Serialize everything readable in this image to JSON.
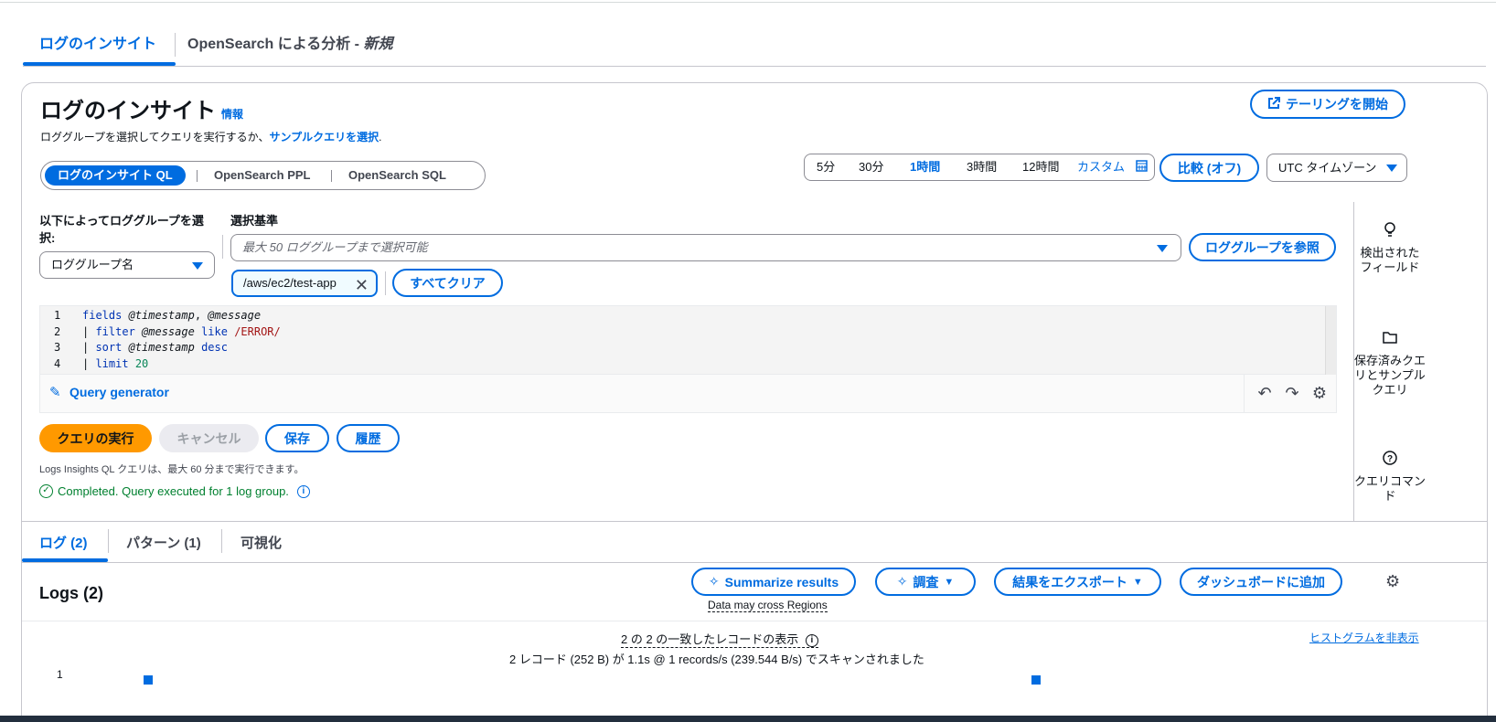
{
  "top_tabs": [
    {
      "label": "ログのインサイト"
    },
    {
      "label_prefix": "OpenSearch による分析 - ",
      "label_suffix": "新規"
    }
  ],
  "header": {
    "title": "ログのインサイト",
    "info": "情報",
    "subtitle": "ロググループを選択してクエリを実行するか、",
    "subtitle_link": "サンプルクエリを選択",
    "subtitle_end": ".",
    "tail_button": "テーリングを開始"
  },
  "query_languages": [
    "ログのインサイト QL",
    "OpenSearch PPL",
    "OpenSearch SQL"
  ],
  "time_range": {
    "options": [
      "5分",
      "30分",
      "1時間",
      "3時間",
      "12時間"
    ],
    "selected": "1時間",
    "custom": "カスタム",
    "compare_button": "比較 (オフ)",
    "timezone": "UTC タイムゾーン"
  },
  "log_group_selection": {
    "select_by_label": "以下によってロググループを選択:",
    "select_by_value": "ロググループ名",
    "criteria_label": "選択基準",
    "criteria_placeholder": "最大 50 ロググループまで選択可能",
    "browse_button": "ロググループを参照",
    "selected_token": "/aws/ec2/test-app",
    "clear_all_button": "すべてクリア"
  },
  "editor": {
    "lines": [
      {
        "n": "1",
        "parts": [
          [
            "kw",
            "fields "
          ],
          [
            "at",
            "@timestamp"
          ],
          [
            "t",
            ", "
          ],
          [
            "at",
            "@message"
          ]
        ]
      },
      {
        "n": "2",
        "parts": [
          [
            "t",
            "| "
          ],
          [
            "kw",
            "filter "
          ],
          [
            "at",
            "@message "
          ],
          [
            "kw",
            "like "
          ],
          [
            "re",
            "/ERROR/"
          ]
        ]
      },
      {
        "n": "3",
        "parts": [
          [
            "t",
            "| "
          ],
          [
            "kw",
            "sort "
          ],
          [
            "at",
            "@timestamp "
          ],
          [
            "kw",
            "desc"
          ]
        ]
      },
      {
        "n": "4",
        "parts": [
          [
            "t",
            "| "
          ],
          [
            "kw",
            "limit "
          ],
          [
            "num",
            "20"
          ]
        ]
      }
    ],
    "query_generator": "Query generator"
  },
  "actions": {
    "run": "クエリの実行",
    "cancel": "キャンセル",
    "save": "保存",
    "history": "履歴",
    "hint": "Logs Insights QL クエリは、最大 60 分まで実行できます。",
    "status": "Completed. Query executed for 1 log group."
  },
  "tools": [
    {
      "icon": "lightbulb-icon",
      "label": "検出されたフィールド"
    },
    {
      "icon": "folder-icon",
      "label": "保存済みクエリとサンプルクエリ"
    },
    {
      "icon": "help-icon",
      "label": "クエリコマンド"
    }
  ],
  "results_tabs": [
    "ログ (2)",
    "パターン (1)",
    "可視化"
  ],
  "logs": {
    "title": "Logs (2)",
    "summarize_button": "Summarize results",
    "cross_regions": "Data may cross Regions",
    "investigate_button": "調査",
    "export_button": "結果をエクスポート",
    "dashboard_button": "ダッシュボードに追加",
    "matched": "2 の 2 の一致したレコードの表示",
    "scanned": "2 レコード (252 B) が 1.1s @ 1 records/s (239.544 B/s) でスキャンされました",
    "hide_histogram": "ヒストグラムを非表示",
    "y_tick": "1"
  },
  "colors": {
    "accent": "#006ce0",
    "run_button": "#ff9900",
    "success": "#00802f"
  }
}
